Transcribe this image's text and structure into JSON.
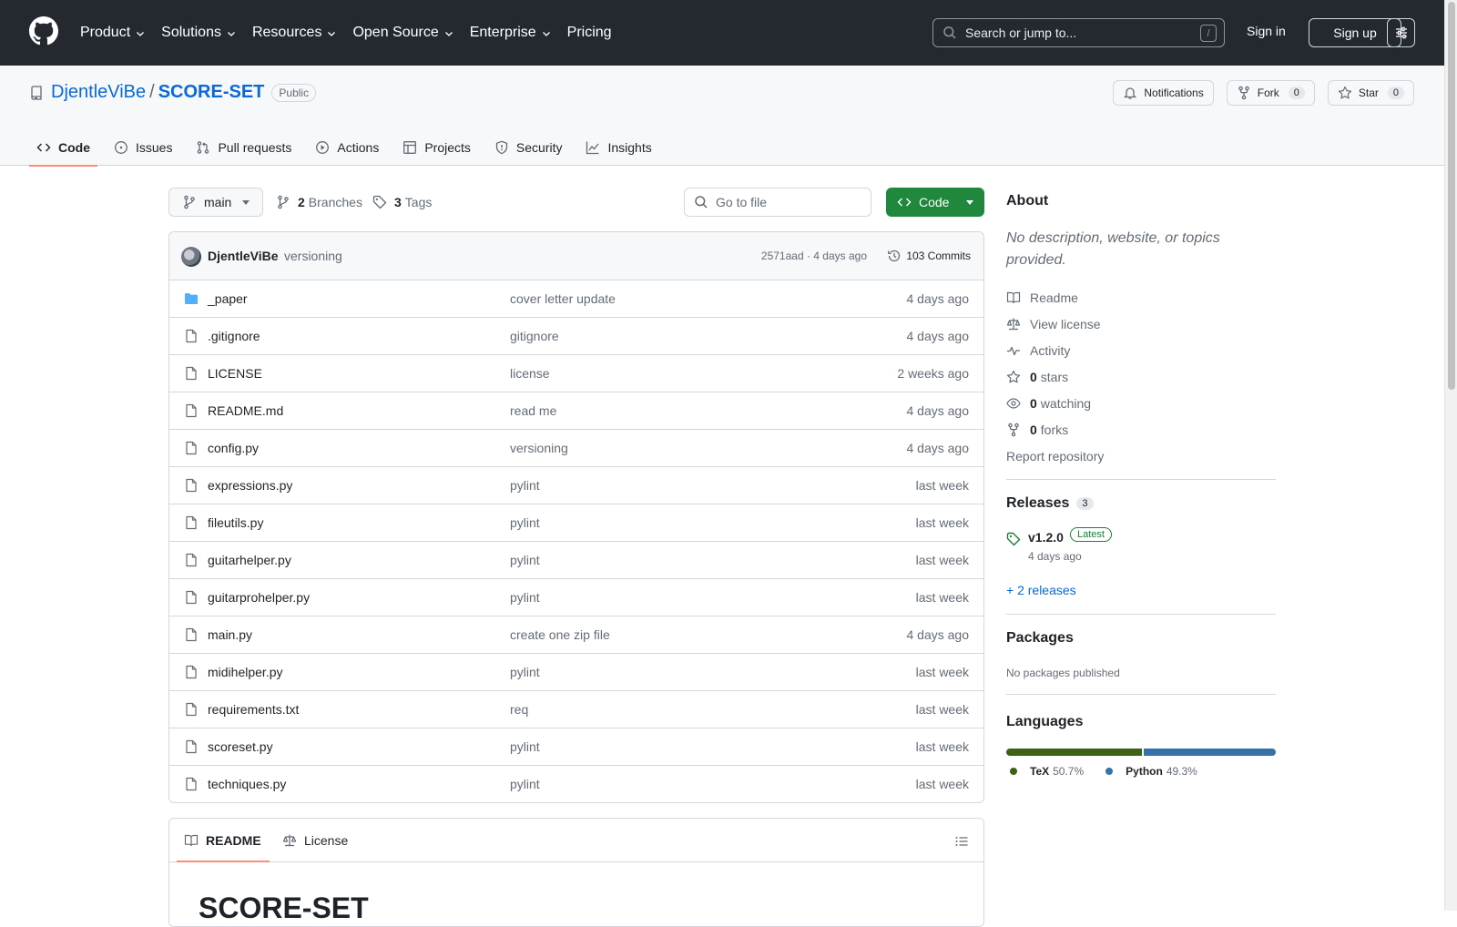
{
  "header": {
    "nav": [
      {
        "label": "Product",
        "has_menu": true
      },
      {
        "label": "Solutions",
        "has_menu": true
      },
      {
        "label": "Resources",
        "has_menu": true
      },
      {
        "label": "Open Source",
        "has_menu": true
      },
      {
        "label": "Enterprise",
        "has_menu": true
      },
      {
        "label": "Pricing",
        "has_menu": false
      }
    ],
    "search_placeholder": "Search or jump to...",
    "search_key": "/",
    "sign_in": "Sign in",
    "sign_up": "Sign up"
  },
  "repo": {
    "owner": "DjentleViBe",
    "separator": "/",
    "name": "SCORE-SET",
    "visibility": "Public",
    "notifications_label": "Notifications",
    "fork_label": "Fork",
    "fork_count": "0",
    "star_label": "Star",
    "star_count": "0",
    "tabs": [
      {
        "label": "Code",
        "icon": "code-icon",
        "active": true
      },
      {
        "label": "Issues",
        "icon": "issue-icon",
        "active": false
      },
      {
        "label": "Pull requests",
        "icon": "pull-request-icon",
        "active": false
      },
      {
        "label": "Actions",
        "icon": "play-icon",
        "active": false
      },
      {
        "label": "Projects",
        "icon": "table-icon",
        "active": false
      },
      {
        "label": "Security",
        "icon": "shield-icon",
        "active": false
      },
      {
        "label": "Insights",
        "icon": "graph-icon",
        "active": false
      }
    ]
  },
  "toolbar": {
    "branch": "main",
    "branches_count": "2",
    "branches_label": "Branches",
    "tags_count": "3",
    "tags_label": "Tags",
    "goto_placeholder": "Go to file",
    "code_label": "Code"
  },
  "commit": {
    "author": "DjentleViBe",
    "message": "versioning",
    "meta": "2571aad · 4 days ago",
    "commits_label": "103 Commits"
  },
  "files": [
    {
      "name": "_paper",
      "type": "folder",
      "message": "cover letter update",
      "date": "4 days ago"
    },
    {
      "name": ".gitignore",
      "type": "file",
      "message": "gitignore",
      "date": "4 days ago"
    },
    {
      "name": "LICENSE",
      "type": "file",
      "message": "license",
      "date": "2 weeks ago"
    },
    {
      "name": "README.md",
      "type": "file",
      "message": "read me",
      "date": "4 days ago"
    },
    {
      "name": "config.py",
      "type": "file",
      "message": "versioning",
      "date": "4 days ago"
    },
    {
      "name": "expressions.py",
      "type": "file",
      "message": "pylint",
      "date": "last week"
    },
    {
      "name": "fileutils.py",
      "type": "file",
      "message": "pylint",
      "date": "last week"
    },
    {
      "name": "guitarhelper.py",
      "type": "file",
      "message": "pylint",
      "date": "last week"
    },
    {
      "name": "guitarprohelper.py",
      "type": "file",
      "message": "pylint",
      "date": "last week"
    },
    {
      "name": "main.py",
      "type": "file",
      "message": "create one zip file",
      "date": "4 days ago"
    },
    {
      "name": "midihelper.py",
      "type": "file",
      "message": "pylint",
      "date": "last week"
    },
    {
      "name": "requirements.txt",
      "type": "file",
      "message": "req",
      "date": "last week"
    },
    {
      "name": "scoreset.py",
      "type": "file",
      "message": "pylint",
      "date": "last week"
    },
    {
      "name": "techniques.py",
      "type": "file",
      "message": "pylint",
      "date": "last week"
    }
  ],
  "readme": {
    "tab_readme": "README",
    "tab_license": "License",
    "heading": "SCORE-SET"
  },
  "sidebar": {
    "about_title": "About",
    "about_desc": "No description, website, or topics provided.",
    "links": [
      {
        "icon": "book-icon",
        "bold": "",
        "label": "Readme"
      },
      {
        "icon": "law-icon",
        "bold": "",
        "label": "View license"
      },
      {
        "icon": "pulse-icon",
        "bold": "",
        "label": "Activity"
      },
      {
        "icon": "star-icon",
        "bold": "0",
        "label": "stars"
      },
      {
        "icon": "eye-icon",
        "bold": "0",
        "label": "watching"
      },
      {
        "icon": "fork-icon",
        "bold": "0",
        "label": "forks"
      },
      {
        "icon": "",
        "bold": "",
        "label": "Report repository"
      }
    ],
    "releases_title": "Releases",
    "releases_count": "3",
    "latest_release": "v1.2.0",
    "latest_badge": "Latest",
    "latest_date": "4 days ago",
    "more_releases": "+ 2 releases",
    "packages_title": "Packages",
    "packages_empty": "No packages published",
    "languages_title": "Languages",
    "languages": [
      {
        "name": "TeX",
        "percent": "50.7%",
        "value": 50.7,
        "color": "#3d6117"
      },
      {
        "name": "Python",
        "percent": "49.3%",
        "value": 49.3,
        "color": "#3572A5"
      }
    ]
  },
  "colors": {
    "accent": "#0969da",
    "header_bg": "#24292f",
    "code_button": "#1f883d",
    "tab_underline": "#fd8c73"
  }
}
